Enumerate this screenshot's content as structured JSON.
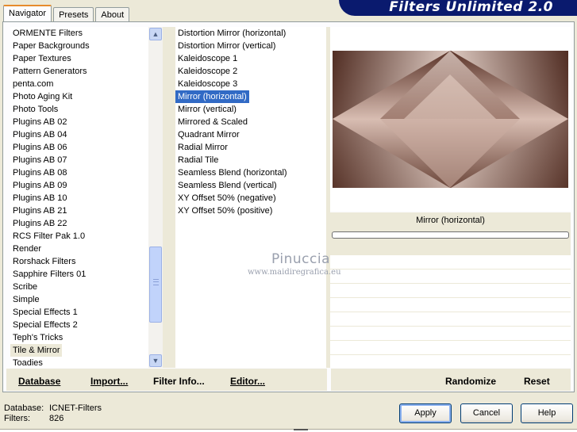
{
  "banner": {
    "title": "Filters Unlimited 2.0"
  },
  "tabs": [
    {
      "label": "Navigator",
      "active": true
    },
    {
      "label": "Presets",
      "active": false
    },
    {
      "label": "About",
      "active": false
    }
  ],
  "categories": [
    "ORMENTE Filters",
    "Paper Backgrounds",
    "Paper Textures",
    "Pattern Generators",
    "penta.com",
    "Photo Aging Kit",
    "Photo Tools",
    "Plugins AB 02",
    "Plugins AB 04",
    "Plugins AB 06",
    "Plugins AB 07",
    "Plugins AB 08",
    "Plugins AB 09",
    "Plugins AB 10",
    "Plugins AB 21",
    "Plugins AB 22",
    "RCS Filter Pak 1.0",
    "Render",
    "Rorshack Filters",
    "Sapphire Filters 01",
    "Scribe",
    "Simple",
    "Special Effects 1",
    "Special Effects 2",
    "Teph's Tricks",
    "Tile & Mirror",
    "Toadies"
  ],
  "selected_category": "Tile & Mirror",
  "filters": [
    "Distortion Mirror (horizontal)",
    "Distortion Mirror (vertical)",
    "Kaleidoscope 1",
    "Kaleidoscope 2",
    "Kaleidoscope 3",
    "Mirror (horizontal)",
    "Mirror (vertical)",
    "Mirrored & Scaled",
    "Quadrant Mirror",
    "Radial Mirror",
    "Radial Tile",
    "Seamless Blend (horizontal)",
    "Seamless Blend (vertical)",
    "XY Offset 50% (negative)",
    "XY Offset 50% (positive)"
  ],
  "selected_filter": "Mirror (horizontal)",
  "preview": {
    "filter_label": "Mirror (horizontal)"
  },
  "bar_left": {
    "database": "Database",
    "import": "Import...",
    "filter_info": "Filter Info...",
    "editor": "Editor..."
  },
  "bar_right": {
    "randomize": "Randomize",
    "reset": "Reset"
  },
  "watermark": {
    "line1": "Pinuccia",
    "line2": "www.maidiregrafica.eu"
  },
  "status": {
    "database_label": "Database:",
    "database_value": "ICNET-Filters",
    "filters_label": "Filters:",
    "filters_value": "826"
  },
  "buttons": {
    "apply": "Apply",
    "cancel": "Cancel",
    "help": "Help"
  },
  "colors": {
    "banner": "#0a1a6e",
    "selection": "#316ac5",
    "tab_accent": "#e68b2c"
  }
}
